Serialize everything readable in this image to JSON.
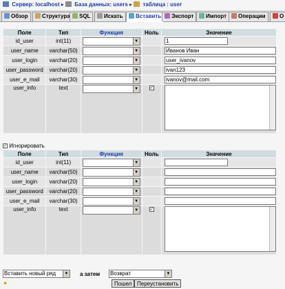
{
  "breadcrumb": {
    "server": "Сервер: localhost",
    "database": "База данных: users",
    "table": "таблица : user"
  },
  "tabs": [
    {
      "label": "Обзор",
      "icon": "browse-icon"
    },
    {
      "label": "Структура",
      "icon": "structure-icon"
    },
    {
      "label": "SQL",
      "icon": "sql-icon"
    },
    {
      "label": "Искать",
      "icon": "search-icon"
    },
    {
      "label": "Вставить",
      "icon": "insert-icon"
    },
    {
      "label": "Экспорт",
      "icon": "export-icon"
    },
    {
      "label": "Импорт",
      "icon": "import-icon"
    },
    {
      "label": "Операции",
      "icon": "operations-icon"
    },
    {
      "label": "О",
      "icon": "empty-icon"
    }
  ],
  "columns": {
    "field": "Поле",
    "type": "Тип",
    "function": "Функция",
    "null": "Ноль",
    "value": "Значение"
  },
  "form1": {
    "rows": [
      {
        "field": "id_user",
        "type": "int(11)",
        "value": "1"
      },
      {
        "field": "user_name",
        "type": "varchar(50)",
        "value": "Иванов Иван"
      },
      {
        "field": "user_login",
        "type": "varchar(20)",
        "value": "user_ivanov"
      },
      {
        "field": "user_password",
        "type": "varchar(20)",
        "value": "ivan123"
      },
      {
        "field": "user_e_mail",
        "type": "varchar(30)",
        "value": "ivanov@mail.com"
      },
      {
        "field": "user_info",
        "type": "text",
        "value": ""
      }
    ]
  },
  "ignore_label": "Игнорировать",
  "form2": {
    "rows": [
      {
        "field": "id_user",
        "type": "int(11)",
        "value": ""
      },
      {
        "field": "user_name",
        "type": "varchar(50)",
        "value": ""
      },
      {
        "field": "user_login",
        "type": "varchar(20)",
        "value": ""
      },
      {
        "field": "user_password",
        "type": "varchar(20)",
        "value": ""
      },
      {
        "field": "user_e_mail",
        "type": "varchar(30)",
        "value": ""
      },
      {
        "field": "user_info",
        "type": "text",
        "value": ""
      }
    ]
  },
  "bottom": {
    "insert_mode": "Вставить новый ряд",
    "then_label": "а затем",
    "then_value": "Возврат",
    "go_button": "Пошел",
    "reset_button": "Переустановить"
  },
  "colors": {
    "link": "#1c3ba6",
    "header_bg": "#d0dce0",
    "row_bg": "#dcdcdc"
  }
}
